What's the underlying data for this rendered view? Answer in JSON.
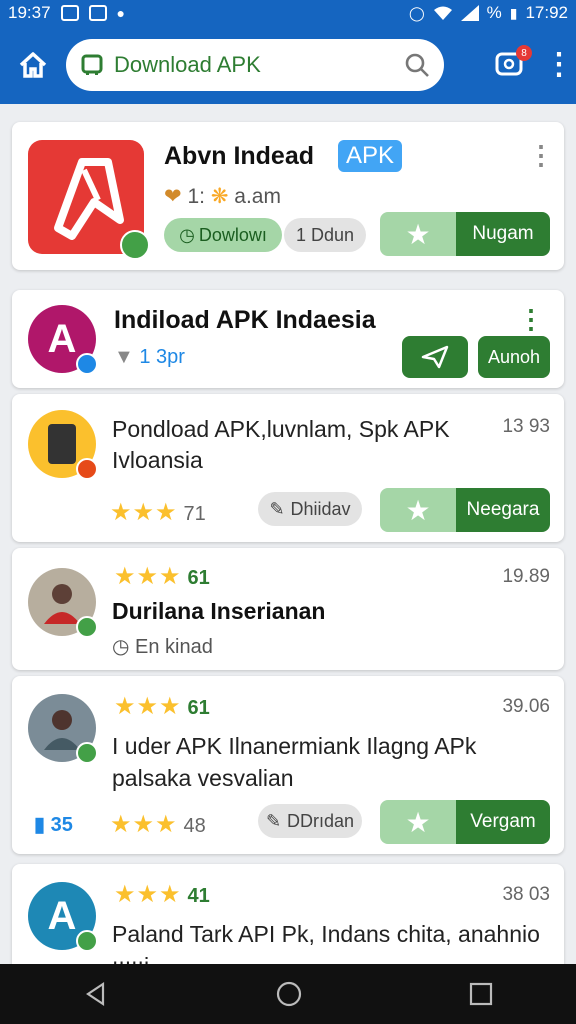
{
  "status": {
    "time_left": "19:37",
    "time_right": "17:92",
    "percent": "%"
  },
  "search": {
    "placeholder": "Download APK",
    "badge": "8"
  },
  "cards": [
    {
      "title": "Abvn Indead",
      "tag": "APK",
      "meta": "1:",
      "meta2": "a.am",
      "chip_download": "Dowlowı",
      "chip_size": "1 Ddun",
      "action": "Nugam"
    },
    {
      "title": "Indiload APK Indaesia",
      "meta": "1 3pr",
      "action": "Aunoh"
    },
    {
      "text": "Pondload APK,luvnlam, Spk APK Ivloansia",
      "time": "13 93",
      "rating": "71",
      "chip": "Dhiidav",
      "action": "Neegara"
    },
    {
      "rating": "61",
      "time": "19.89",
      "title": "Durilana Inserianan",
      "sub": "En kinad"
    },
    {
      "rating_top": "61",
      "time": "39.06",
      "text": "I uder APK Ilnanermiank Ilagng APk palsaka vesvalian",
      "count": "35",
      "rating": "48",
      "chip": "DDrıdan",
      "action": "Vergam"
    },
    {
      "rating": "41",
      "time": "38 03",
      "text": "Paland Tark API Pk, Indans chita, anahnio ıııııi"
    }
  ]
}
